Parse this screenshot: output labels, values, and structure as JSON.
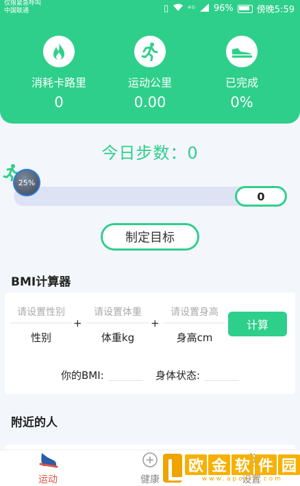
{
  "status_bar": {
    "carrier_line1": "仅限紧急呼叫",
    "carrier_line2": "中国联通",
    "signal_icons": "⁴ᴳ",
    "battery_percent": "96%",
    "time": "傍晚5:59"
  },
  "header": {
    "stats": [
      {
        "icon": "fire-icon",
        "label": "消耗卡路里",
        "value": "0"
      },
      {
        "icon": "runner-icon",
        "label": "运动公里",
        "value": "0.00"
      },
      {
        "icon": "shoe-icon",
        "label": "已完成",
        "value": "0%"
      }
    ]
  },
  "steps": {
    "title": "今日步数：0",
    "progress_label": "25%",
    "count": "0",
    "goal_button": "制定目标"
  },
  "bmi": {
    "title": "BMI计算器",
    "gender_placeholder": "请设置性别",
    "gender_unit": "性别",
    "weight_placeholder": "请设置体重",
    "weight_unit": "体重kg",
    "height_placeholder": "请设置身高",
    "height_unit": "身高cm",
    "plus": "+",
    "calc_button": "计算",
    "result_label": "你的BMI:",
    "status_label": "身体状态:"
  },
  "nearby": {
    "title": "附近的人"
  },
  "tabbar": {
    "tabs": [
      {
        "icon": "shoe-icon",
        "label": "运动",
        "active": true
      },
      {
        "icon": "heart-plus-icon",
        "label": "健康",
        "active": false
      },
      {
        "icon": "gear-icon",
        "label": "设置",
        "active": false
      }
    ]
  },
  "watermark": {
    "chars": [
      "欧",
      "金",
      "软",
      "件",
      "园"
    ],
    "url": "www.apoxin.com"
  },
  "colors": {
    "accent": "#2ecf8a",
    "active_tab": "#e0543e",
    "watermark": "#f0a400"
  }
}
